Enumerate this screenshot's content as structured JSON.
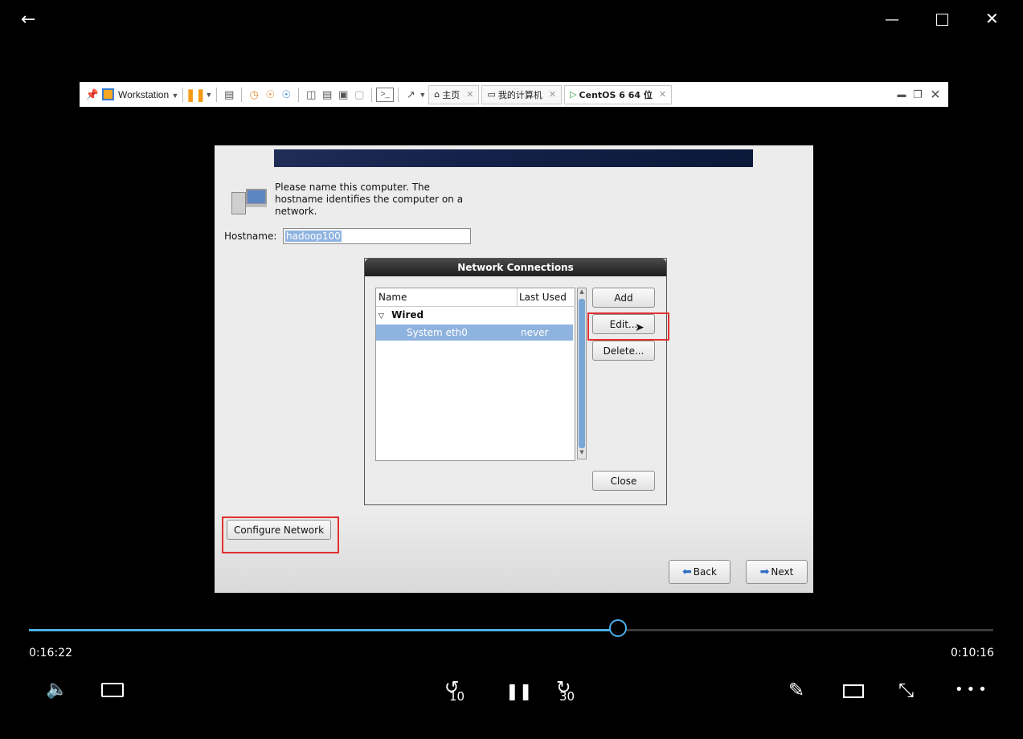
{
  "toolbar": {
    "workstation_label": "Workstation",
    "tabs": [
      {
        "label": "主页",
        "icon": "home-icon"
      },
      {
        "label": "我的计算机",
        "icon": "computer-icon"
      },
      {
        "label": "CentOS 6 64 位",
        "icon": "vm-running-icon"
      }
    ]
  },
  "installer": {
    "prompt": [
      "Please name this computer.  The",
      "hostname identifies the computer on a",
      "network."
    ],
    "hostname_label": "Hostname:",
    "hostname_value": "hadoop100",
    "configure_network_label": "Configure Network",
    "back_label": "Back",
    "next_label": "Next"
  },
  "dialog": {
    "title": "Network Connections",
    "columns": {
      "name": "Name",
      "last_used": "Last Used"
    },
    "group": "Wired",
    "rows": [
      {
        "name": "System eth0",
        "last_used": "never"
      }
    ],
    "add_label": "Add",
    "edit_label": "Edit...",
    "delete_label": "Delete...",
    "close_label": "Close"
  },
  "player": {
    "elapsed": "0:16:22",
    "remaining": "0:10:16",
    "progress": 0.611,
    "skip_back_label": "10",
    "skip_forward_label": "30"
  },
  "colors": {
    "accent": "#4aaee8",
    "highlight": "#e03030",
    "selection": "#8fb3df"
  }
}
